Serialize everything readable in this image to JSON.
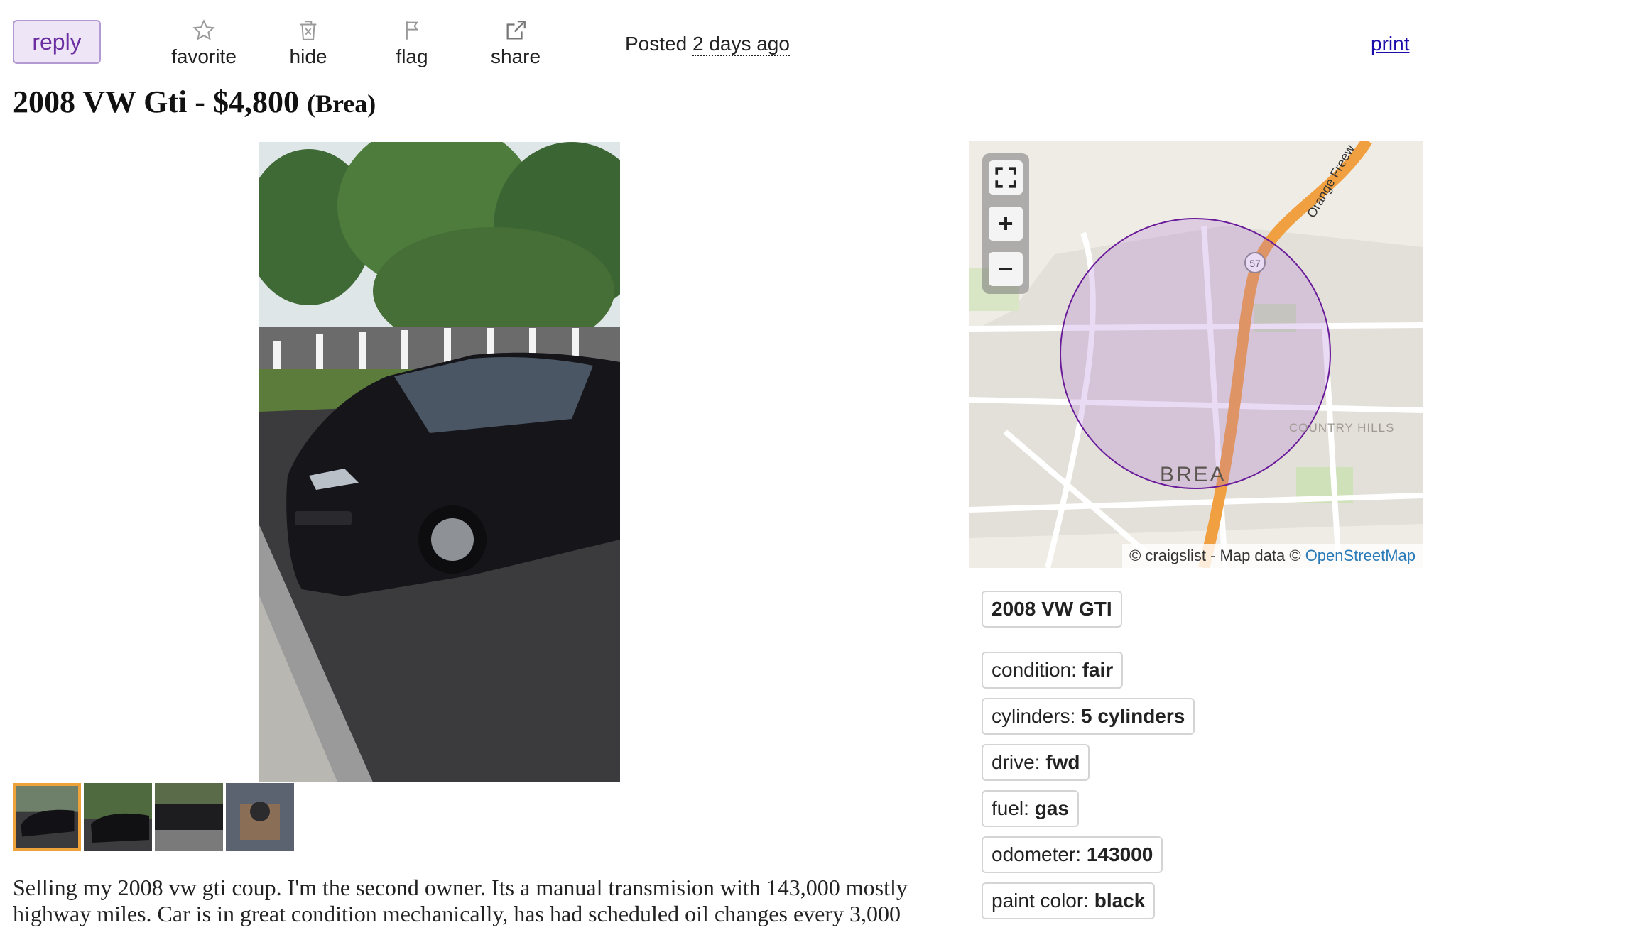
{
  "actions": {
    "reply": "reply",
    "favorite": "favorite",
    "hide": "hide",
    "flag": "flag",
    "share": "share",
    "posted_prefix": "Posted",
    "posted_time": "2 days ago",
    "print": "print"
  },
  "posting": {
    "title": "2008 VW Gti - $4,800",
    "location": "(Brea)"
  },
  "body": {
    "text": "Selling my 2008 vw gti coup. I'm the second owner. Its a manual transmision with 143,000 mostly highway miles. Car is in great condition mechanically, has had scheduled oil changes every 3,000"
  },
  "map": {
    "place_label": "BREA",
    "area_label": "COUNTRY HILLS",
    "road_label": "Orange Freew",
    "route_shield": "57",
    "attribution_prefix": "© craigslist - Map data ©",
    "attribution_link": "OpenStreetMap"
  },
  "attributes": {
    "headline": "2008 VW GTI",
    "items": [
      {
        "key": "condition:",
        "value": "fair"
      },
      {
        "key": "cylinders:",
        "value": "5 cylinders"
      },
      {
        "key": "drive:",
        "value": "fwd"
      },
      {
        "key": "fuel:",
        "value": "gas"
      },
      {
        "key": "odometer:",
        "value": "143000"
      },
      {
        "key": "paint color:",
        "value": "black"
      }
    ]
  },
  "colors": {
    "reply_bg": "#eee6f7",
    "reply_border": "#b49ad2",
    "reply_text": "#6a2ea0",
    "link": "#1a0dab",
    "thumb_active": "#f0a23a",
    "map_circle": "#6a1b9a",
    "freeway": "#f0a040"
  }
}
